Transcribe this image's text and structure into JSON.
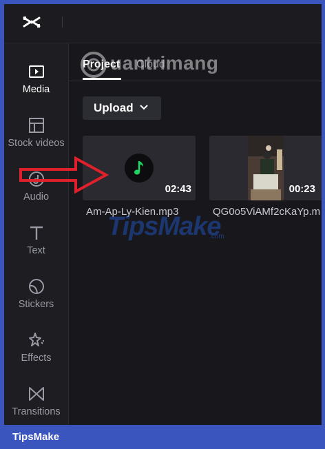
{
  "sidebar": {
    "items": [
      {
        "label": "Media",
        "icon": "media-icon"
      },
      {
        "label": "Stock videos",
        "icon": "stock-videos-icon"
      },
      {
        "label": "Audio",
        "icon": "audio-icon"
      },
      {
        "label": "Text",
        "icon": "text-icon"
      },
      {
        "label": "Stickers",
        "icon": "stickers-icon"
      },
      {
        "label": "Effects",
        "icon": "effects-icon"
      },
      {
        "label": "Transitions",
        "icon": "transitions-icon"
      }
    ]
  },
  "tabs": {
    "project": "Project",
    "cloud": "Cloud"
  },
  "upload": {
    "label": "Upload"
  },
  "media": [
    {
      "name": "Am-Ap-Ly-Kien.mp3",
      "duration": "02:43"
    },
    {
      "name": "QG0o5ViAMf2cKaYp.m",
      "duration": "00:23"
    }
  ],
  "watermarks": {
    "top": "uantrimang",
    "middle": "TipsMake",
    "middle_small": ".com"
  },
  "footer": {
    "brand": "TipsMake"
  },
  "colors": {
    "accent_green": "#1ed760",
    "arrow_red": "#e0202a",
    "frame_blue": "#3b55bf"
  }
}
